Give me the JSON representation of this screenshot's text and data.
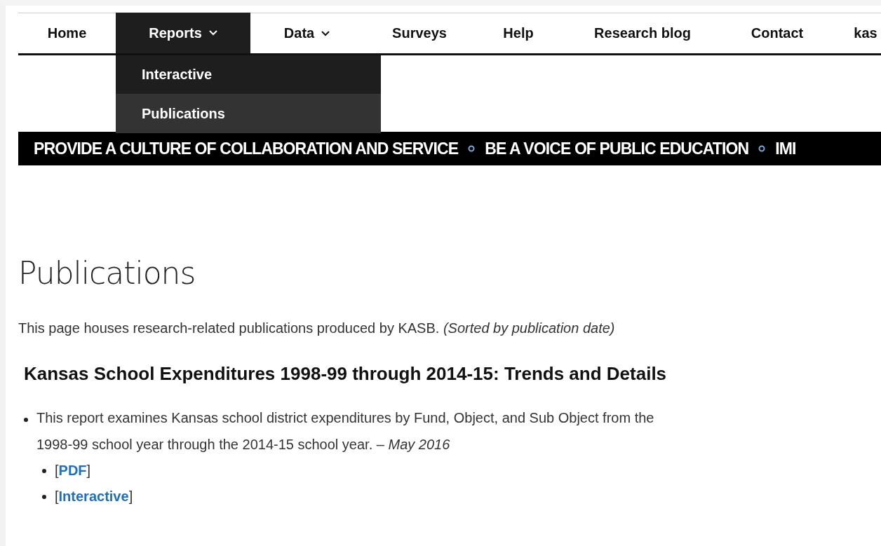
{
  "nav": {
    "items": [
      {
        "label": "Home",
        "has_menu": false,
        "selected": false
      },
      {
        "label": "Reports",
        "has_menu": true,
        "selected": true,
        "expanded": true,
        "menu": [
          {
            "label": "Interactive",
            "selected": false
          },
          {
            "label": "Publications",
            "selected": true
          }
        ]
      },
      {
        "label": "Data",
        "has_menu": true,
        "selected": false
      },
      {
        "label": "Surveys",
        "has_menu": false,
        "selected": false
      },
      {
        "label": "Help",
        "has_menu": false,
        "selected": false
      },
      {
        "label": "Research blog",
        "has_menu": false,
        "selected": false
      },
      {
        "label": "Contact",
        "has_menu": false,
        "selected": false
      },
      {
        "label": "kas",
        "has_menu": false,
        "selected": false
      }
    ]
  },
  "ticker": [
    "PROVIDE A CULTURE OF COLLABORATION AND SERVICE",
    "BE A VOICE OF PUBLIC EDUCATION",
    "IMI"
  ],
  "page": {
    "title": "Publications",
    "intro": "This page houses research-related publications produced by KASB.  *(Sorted by publication date)*",
    "sections": [
      {
        "title": "Kansas School Expenditures 1998-99 through 2014-15:  Trends and Details",
        "items": [
          {
            "text": "This report examines Kansas school district expenditures by Fund, Object, and Sub Object from the 1998-99 school year through the 2014-15 school year. – *May 2016*",
            "links": [
              "[**PDF**]",
              "[**Interactive**]"
            ]
          }
        ]
      }
    ]
  }
}
